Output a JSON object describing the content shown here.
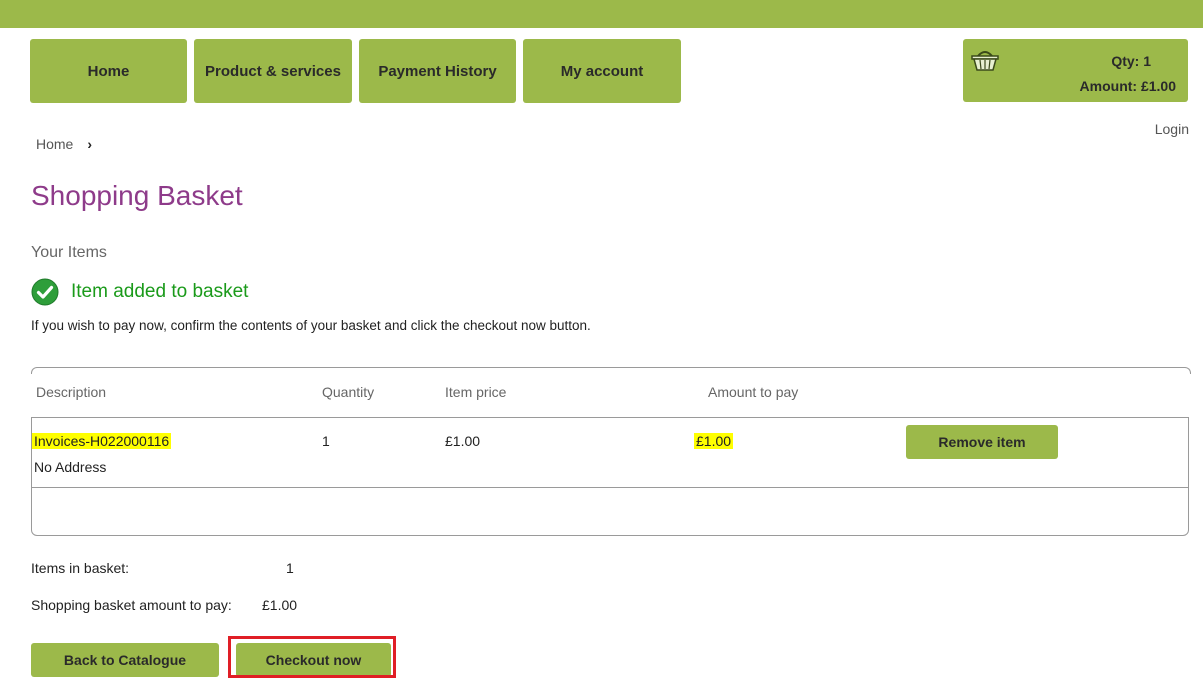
{
  "nav": {
    "home": "Home",
    "products": "Product & services",
    "payment_history": "Payment History",
    "my_account": "My account"
  },
  "basket_widget": {
    "icon": "basket-icon",
    "qty": "Qty: 1",
    "amount": "Amount: £1.00"
  },
  "breadcrumb": {
    "home": "Home",
    "separator": "›"
  },
  "login": "Login",
  "page_title": "Shopping Basket",
  "your_items": "Your Items",
  "status": {
    "icon": "check-circle-icon",
    "message": "Item added to basket"
  },
  "instructions": "If you wish to pay now, confirm the contents of your basket and click the checkout now button.",
  "table": {
    "headers": {
      "description": "Description",
      "quantity": "Quantity",
      "item_price": "Item price",
      "amount_to_pay": "Amount to pay"
    },
    "rows": [
      {
        "description": "Invoices-H022000116",
        "address": "No Address",
        "quantity": "1",
        "item_price": "£1.00",
        "amount_to_pay": "£1.00",
        "remove_label": "Remove item"
      }
    ]
  },
  "summary": {
    "items_label": "Items in basket:",
    "items_value": "1",
    "amount_label": "Shopping basket amount to pay:",
    "amount_value": "£1.00"
  },
  "actions": {
    "back": "Back to Catalogue",
    "checkout": "Checkout now"
  },
  "colors": {
    "brand_green": "#9cb94a",
    "title_purple": "#8e3b8a",
    "success_green": "#1a9a1a",
    "highlight": "#ffff00",
    "annotation_red": "#e01e26"
  }
}
